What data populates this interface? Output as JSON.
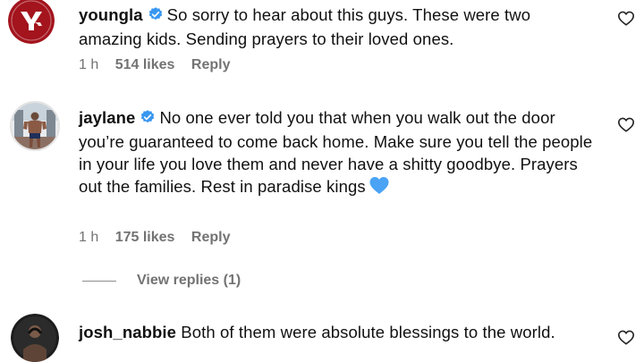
{
  "comments": [
    {
      "username": "youngla",
      "text": "So sorry to hear about this guys. These were two amazing kids. Sending prayers to their loved ones.",
      "time": "1 h",
      "likes": "514 likes",
      "reply": "Reply"
    },
    {
      "username": "jaylane",
      "text": "No one ever told you that when you walk out the door you’re guaranteed to come back home. Make sure you tell the people in your life you love them and never have a shitty goodbye. Prayers out the families. Rest in paradise kings",
      "time": "1 h",
      "likes": "175 likes",
      "reply": "Reply"
    },
    {
      "username": "josh_nabbie",
      "text": "Both of them were absolute blessings to the world."
    }
  ],
  "view_replies": "View replies (1)",
  "avatar_logo_text": "YLA",
  "colors": {
    "verified": "#3897f0",
    "meta_text": "#737373",
    "blue_heart": "#4aa3f5",
    "brand_red": "#a3141d"
  },
  "icons": {
    "verified": "verified-badge-icon",
    "like": "heart-outline-icon",
    "emoji": "blue-heart-emoji"
  }
}
